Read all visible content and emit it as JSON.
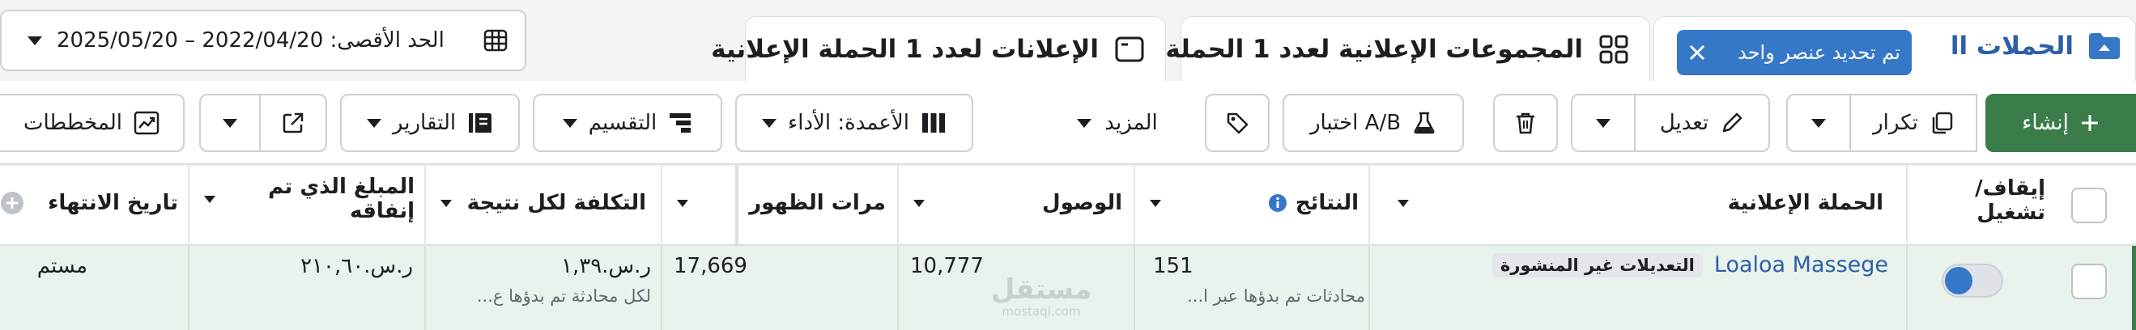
{
  "header": {
    "date_range": "الحد الأقصى: 2022/04/20 – 2025/05/20"
  },
  "tabs": {
    "campaigns_label": "الحملات اا",
    "selection_badge": "تم تحديد عنصر واحد",
    "adsets_label": "المجموعات الإعلانية لعدد 1 الحملة",
    "ads_label": "الإعلانات لعدد 1 الحملة الإعلانية"
  },
  "toolbar": {
    "create": "إنشاء",
    "duplicate": "تكرار",
    "edit": "تعديل",
    "ab_test": "اختبار A/B",
    "more": "المزيد",
    "columns": "الأعمدة: الأداء",
    "breakdown": "التقسيم",
    "reports": "التقارير",
    "charts": "المخططات"
  },
  "table": {
    "headers": {
      "toggle_line1": "إيقاف/",
      "toggle_line2": "تشغيل",
      "campaign": "الحملة الإعلانية",
      "results": "النتائج",
      "reach": "الوصول",
      "impressions": "مرات الظهور",
      "cost_per_result": "التكلفة لكل نتيجة",
      "amount_spent_line1": "المبلغ الذي تم",
      "amount_spent_line2": "إنفاقه",
      "end_date": "تاريخ الانتهاء"
    },
    "row": {
      "campaign_name": "Loaloa Massege",
      "unpublished_badge": "التعديلات غير المنشورة",
      "results": "151",
      "results_sub": "محادثات تم بدؤها عبر ا...",
      "reach": "10,777",
      "impressions": "17,669",
      "cost_per_result": "ر.س.١,٣٩",
      "cost_sub": "لكل محادثة تم بدؤها ع...",
      "amount_spent": "ر.س.٢١٠,٦٠",
      "end_date": "مستم",
      "toggle_on": true
    }
  },
  "watermark": {
    "text": "مستقل",
    "sub": "mostaql.com"
  },
  "colors": {
    "brand_blue": "#3578c8",
    "create_green": "#3a7d4a",
    "row_green": "#e9f3ec",
    "link_blue": "#2e5fa8"
  }
}
